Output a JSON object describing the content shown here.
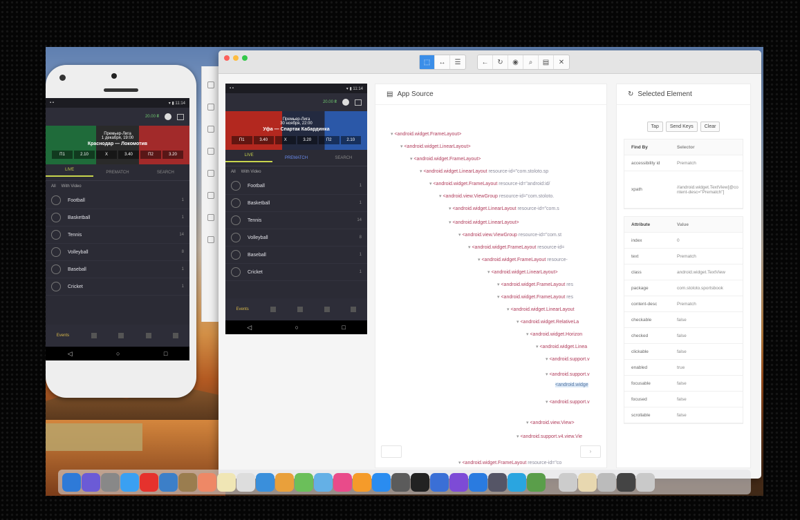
{
  "phone": {
    "balance": "20.00 ₴",
    "banner_lines": [
      "Премьер-Лига",
      "1 декабря, 19:00"
    ],
    "banner_title": "Краснодар — Локомотив",
    "odds": [
      "П1",
      "2.10",
      "X",
      "3.40",
      "П2",
      "3.20"
    ],
    "tabs": [
      "LIVE",
      "PREMATCH",
      "SEARCH"
    ],
    "filter": [
      "All",
      "With Video"
    ],
    "sports": [
      {
        "name": "Football",
        "count": "1"
      },
      {
        "name": "Basketball",
        "count": "1"
      },
      {
        "name": "Tennis",
        "count": "14"
      },
      {
        "name": "Volleyball",
        "count": "8"
      },
      {
        "name": "Baseball",
        "count": "1"
      },
      {
        "name": "Cricket",
        "count": "1"
      }
    ],
    "bottom_nav_label": "Events"
  },
  "emulator": {
    "balance": "20.00 ₴",
    "banner_lines": [
      "Премьер-Лига",
      "30 ноября, 22:00"
    ],
    "banner_title": "Уфа — Спартак Кабардинка",
    "odds": [
      "П1",
      "3.40",
      "X",
      "3.20",
      "П2",
      "2.10"
    ],
    "tabs": [
      "LIVE",
      "PREMATCH",
      "SEARCH"
    ],
    "filter": [
      "All",
      "With Video"
    ],
    "sports": [
      {
        "name": "Football",
        "count": "1"
      },
      {
        "name": "Basketball",
        "count": "1"
      },
      {
        "name": "Tennis",
        "count": "14"
      },
      {
        "name": "Volleyball",
        "count": "8"
      },
      {
        "name": "Baseball",
        "count": "1"
      },
      {
        "name": "Cricket",
        "count": "1"
      }
    ],
    "bottom_nav_label": "Events"
  },
  "app_source": {
    "title": "App Source",
    "nodes": [
      {
        "tag": "<android.widget.FrameLayout>",
        "attr": ""
      },
      {
        "tag": "<android.widget.LinearLayout>",
        "attr": ""
      },
      {
        "tag": "<android.widget.FrameLayout>",
        "attr": ""
      },
      {
        "tag": "<android.widget.LinearLayout",
        "attr": " resource-id=\"com.stoloto.sp"
      },
      {
        "tag": "<android.widget.FrameLayout",
        "attr": " resource-id=\"android:id/"
      },
      {
        "tag": "<android.view.ViewGroup",
        "attr": " resource-id=\"com.stoloto."
      },
      {
        "tag": "<android.widget.LinearLayout",
        "attr": " resource-id=\"com.s"
      },
      {
        "tag": "<android.widget.LinearLayout>",
        "attr": ""
      },
      {
        "tag": "<android.view.ViewGroup",
        "attr": " resource-id=\"com.st"
      },
      {
        "tag": "<android.widget.FrameLayout",
        "attr": " resource-id="
      },
      {
        "tag": "<android.widget.FrameLayout",
        "attr": " resource-"
      },
      {
        "tag": "<android.widget.LinearLayout>",
        "attr": ""
      },
      {
        "tag": "<android.widget.FrameLayout",
        "attr": " res"
      },
      {
        "tag": "<android.widget.FrameLayout",
        "attr": " res"
      },
      {
        "tag": "<android.widget.LinearLayout",
        "attr": ""
      },
      {
        "tag": "<android.widget.RelativeLa",
        "attr": ""
      },
      {
        "tag": "<android.widget.Horizon",
        "attr": ""
      },
      {
        "tag": "<android.widget.Linea",
        "attr": ""
      },
      {
        "tag": "<android.support.v",
        "attr": ""
      },
      {
        "tag": "<android.support.v",
        "attr": ""
      },
      {
        "tag": "<android.widge",
        "attr": ""
      },
      {
        "tag": "<android.support.v",
        "attr": ""
      },
      {
        "tag": "<android.view.View>",
        "attr": ""
      },
      {
        "tag": "<android.support.v4.view.Vie",
        "attr": ""
      },
      {
        "tag": "<android.widget.FrameLayout",
        "attr": " resource-id=\"co"
      }
    ]
  },
  "selected_element": {
    "title": "Selected Element",
    "buttons": [
      "Tap",
      "Send Keys",
      "Clear"
    ],
    "find_header": [
      "Find By",
      "Selector"
    ],
    "find_rows": [
      [
        "accessibility id",
        "Prematch"
      ],
      [
        "xpath",
        "//android.widget.TextView[@content-desc=\"Prematch\"]"
      ]
    ],
    "attr_header": [
      "Attribute",
      "Value"
    ],
    "attr_rows": [
      [
        "index",
        "0"
      ],
      [
        "text",
        "Prematch"
      ],
      [
        "class",
        "android.widget.TextView"
      ],
      [
        "package",
        "com.stoloto.sportsbook"
      ],
      [
        "content-desc",
        "Prematch"
      ],
      [
        "checkable",
        "false"
      ],
      [
        "checked",
        "false"
      ],
      [
        "clickable",
        "false"
      ],
      [
        "enabled",
        "true"
      ],
      [
        "focusable",
        "false"
      ],
      [
        "focused",
        "false"
      ],
      [
        "scrollable",
        "false"
      ]
    ]
  },
  "colors": {
    "accent_yellow": "#c9d64d",
    "accent_blue": "#3b8ee8",
    "tag_red": "#b03b5a"
  }
}
